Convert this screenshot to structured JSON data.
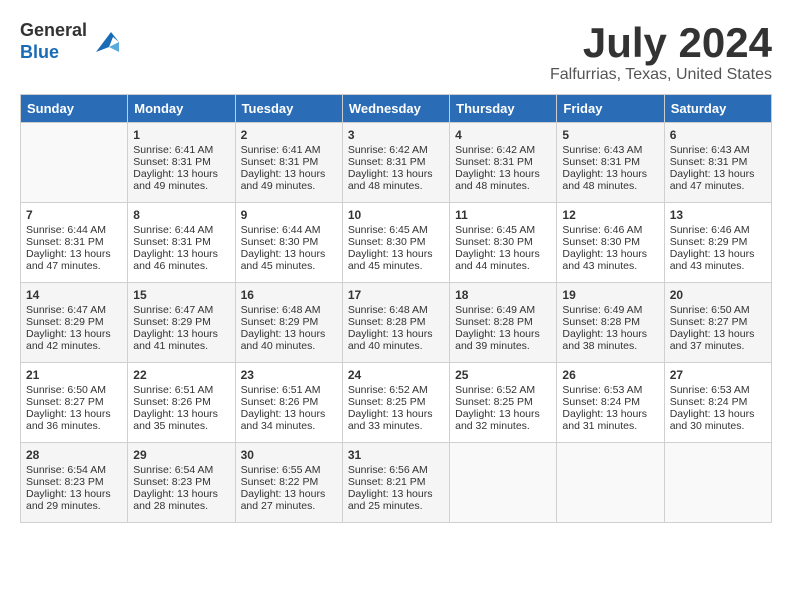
{
  "header": {
    "logo_line1": "General",
    "logo_line2": "Blue",
    "month_title": "July 2024",
    "location": "Falfurrias, Texas, United States"
  },
  "weekdays": [
    "Sunday",
    "Monday",
    "Tuesday",
    "Wednesday",
    "Thursday",
    "Friday",
    "Saturday"
  ],
  "weeks": [
    [
      {
        "day": "",
        "sunrise": "",
        "sunset": "",
        "daylight": ""
      },
      {
        "day": "1",
        "sunrise": "Sunrise: 6:41 AM",
        "sunset": "Sunset: 8:31 PM",
        "daylight": "Daylight: 13 hours and 49 minutes."
      },
      {
        "day": "2",
        "sunrise": "Sunrise: 6:41 AM",
        "sunset": "Sunset: 8:31 PM",
        "daylight": "Daylight: 13 hours and 49 minutes."
      },
      {
        "day": "3",
        "sunrise": "Sunrise: 6:42 AM",
        "sunset": "Sunset: 8:31 PM",
        "daylight": "Daylight: 13 hours and 48 minutes."
      },
      {
        "day": "4",
        "sunrise": "Sunrise: 6:42 AM",
        "sunset": "Sunset: 8:31 PM",
        "daylight": "Daylight: 13 hours and 48 minutes."
      },
      {
        "day": "5",
        "sunrise": "Sunrise: 6:43 AM",
        "sunset": "Sunset: 8:31 PM",
        "daylight": "Daylight: 13 hours and 48 minutes."
      },
      {
        "day": "6",
        "sunrise": "Sunrise: 6:43 AM",
        "sunset": "Sunset: 8:31 PM",
        "daylight": "Daylight: 13 hours and 47 minutes."
      }
    ],
    [
      {
        "day": "7",
        "sunrise": "Sunrise: 6:44 AM",
        "sunset": "Sunset: 8:31 PM",
        "daylight": "Daylight: 13 hours and 47 minutes."
      },
      {
        "day": "8",
        "sunrise": "Sunrise: 6:44 AM",
        "sunset": "Sunset: 8:31 PM",
        "daylight": "Daylight: 13 hours and 46 minutes."
      },
      {
        "day": "9",
        "sunrise": "Sunrise: 6:44 AM",
        "sunset": "Sunset: 8:30 PM",
        "daylight": "Daylight: 13 hours and 45 minutes."
      },
      {
        "day": "10",
        "sunrise": "Sunrise: 6:45 AM",
        "sunset": "Sunset: 8:30 PM",
        "daylight": "Daylight: 13 hours and 45 minutes."
      },
      {
        "day": "11",
        "sunrise": "Sunrise: 6:45 AM",
        "sunset": "Sunset: 8:30 PM",
        "daylight": "Daylight: 13 hours and 44 minutes."
      },
      {
        "day": "12",
        "sunrise": "Sunrise: 6:46 AM",
        "sunset": "Sunset: 8:30 PM",
        "daylight": "Daylight: 13 hours and 43 minutes."
      },
      {
        "day": "13",
        "sunrise": "Sunrise: 6:46 AM",
        "sunset": "Sunset: 8:29 PM",
        "daylight": "Daylight: 13 hours and 43 minutes."
      }
    ],
    [
      {
        "day": "14",
        "sunrise": "Sunrise: 6:47 AM",
        "sunset": "Sunset: 8:29 PM",
        "daylight": "Daylight: 13 hours and 42 minutes."
      },
      {
        "day": "15",
        "sunrise": "Sunrise: 6:47 AM",
        "sunset": "Sunset: 8:29 PM",
        "daylight": "Daylight: 13 hours and 41 minutes."
      },
      {
        "day": "16",
        "sunrise": "Sunrise: 6:48 AM",
        "sunset": "Sunset: 8:29 PM",
        "daylight": "Daylight: 13 hours and 40 minutes."
      },
      {
        "day": "17",
        "sunrise": "Sunrise: 6:48 AM",
        "sunset": "Sunset: 8:28 PM",
        "daylight": "Daylight: 13 hours and 40 minutes."
      },
      {
        "day": "18",
        "sunrise": "Sunrise: 6:49 AM",
        "sunset": "Sunset: 8:28 PM",
        "daylight": "Daylight: 13 hours and 39 minutes."
      },
      {
        "day": "19",
        "sunrise": "Sunrise: 6:49 AM",
        "sunset": "Sunset: 8:28 PM",
        "daylight": "Daylight: 13 hours and 38 minutes."
      },
      {
        "day": "20",
        "sunrise": "Sunrise: 6:50 AM",
        "sunset": "Sunset: 8:27 PM",
        "daylight": "Daylight: 13 hours and 37 minutes."
      }
    ],
    [
      {
        "day": "21",
        "sunrise": "Sunrise: 6:50 AM",
        "sunset": "Sunset: 8:27 PM",
        "daylight": "Daylight: 13 hours and 36 minutes."
      },
      {
        "day": "22",
        "sunrise": "Sunrise: 6:51 AM",
        "sunset": "Sunset: 8:26 PM",
        "daylight": "Daylight: 13 hours and 35 minutes."
      },
      {
        "day": "23",
        "sunrise": "Sunrise: 6:51 AM",
        "sunset": "Sunset: 8:26 PM",
        "daylight": "Daylight: 13 hours and 34 minutes."
      },
      {
        "day": "24",
        "sunrise": "Sunrise: 6:52 AM",
        "sunset": "Sunset: 8:25 PM",
        "daylight": "Daylight: 13 hours and 33 minutes."
      },
      {
        "day": "25",
        "sunrise": "Sunrise: 6:52 AM",
        "sunset": "Sunset: 8:25 PM",
        "daylight": "Daylight: 13 hours and 32 minutes."
      },
      {
        "day": "26",
        "sunrise": "Sunrise: 6:53 AM",
        "sunset": "Sunset: 8:24 PM",
        "daylight": "Daylight: 13 hours and 31 minutes."
      },
      {
        "day": "27",
        "sunrise": "Sunrise: 6:53 AM",
        "sunset": "Sunset: 8:24 PM",
        "daylight": "Daylight: 13 hours and 30 minutes."
      }
    ],
    [
      {
        "day": "28",
        "sunrise": "Sunrise: 6:54 AM",
        "sunset": "Sunset: 8:23 PM",
        "daylight": "Daylight: 13 hours and 29 minutes."
      },
      {
        "day": "29",
        "sunrise": "Sunrise: 6:54 AM",
        "sunset": "Sunset: 8:23 PM",
        "daylight": "Daylight: 13 hours and 28 minutes."
      },
      {
        "day": "30",
        "sunrise": "Sunrise: 6:55 AM",
        "sunset": "Sunset: 8:22 PM",
        "daylight": "Daylight: 13 hours and 27 minutes."
      },
      {
        "day": "31",
        "sunrise": "Sunrise: 6:56 AM",
        "sunset": "Sunset: 8:21 PM",
        "daylight": "Daylight: 13 hours and 25 minutes."
      },
      {
        "day": "",
        "sunrise": "",
        "sunset": "",
        "daylight": ""
      },
      {
        "day": "",
        "sunrise": "",
        "sunset": "",
        "daylight": ""
      },
      {
        "day": "",
        "sunrise": "",
        "sunset": "",
        "daylight": ""
      }
    ]
  ]
}
